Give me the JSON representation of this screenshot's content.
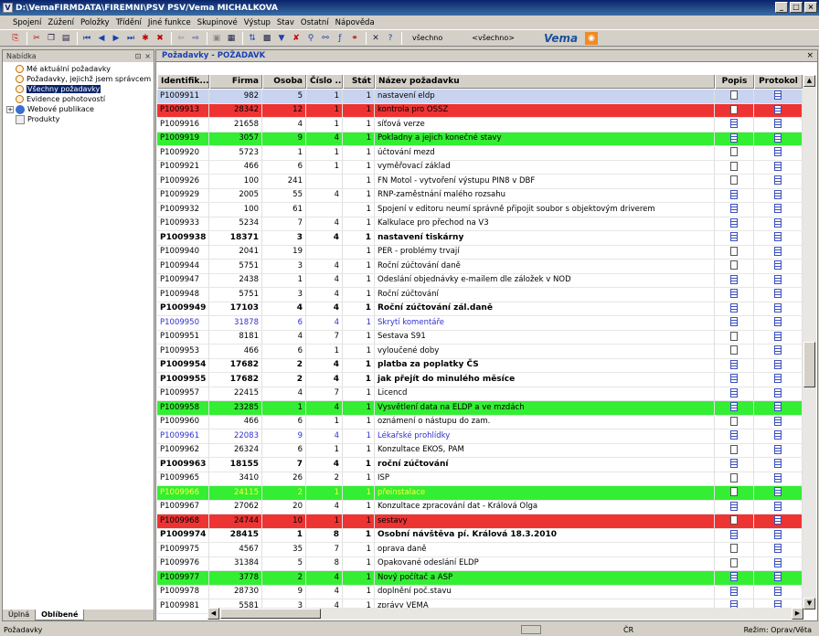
{
  "window": {
    "title": "D:\\VemaFIRMDATA\\FIREMNI\\PSV PSV/Vema MICHALKOVA"
  },
  "menu": [
    "Spojení",
    "Zúžení",
    "Položky",
    "Třídění",
    "Jiné funkce",
    "Skupinové",
    "Výstup",
    "Stav",
    "Ostatní",
    "Nápověda"
  ],
  "toolbar": {
    "filter1": "všechno",
    "filter2": "<všechno>",
    "brand": "Vema"
  },
  "left_panel": {
    "title": "Nabídka",
    "items": [
      "Mé aktuální požadavky",
      "Požadavky, jejichž jsem správcem",
      "Všechny požadavky",
      "Evidence pohotovostí",
      "Webové publikace",
      "Produkty"
    ],
    "tabs": [
      "Úplná",
      "Oblíbené"
    ]
  },
  "main": {
    "title": "Požadavky - POŽADAVK"
  },
  "columns": [
    "Identifik...",
    "Firma",
    "Osoba",
    "Číslo ...",
    "Stát",
    "Název požadavku",
    "Popis",
    "Protokol"
  ],
  "rows": [
    [
      "P1009911",
      "982",
      "5",
      "1",
      "1",
      "nastavení eldp",
      "sel",
      "page",
      "lines"
    ],
    [
      "P1009913",
      "28342",
      "12",
      "1",
      "1",
      "kontrola pro OSSZ",
      "red",
      "page",
      "lines"
    ],
    [
      "P1009916",
      "21658",
      "4",
      "1",
      "1",
      "síťová verze",
      "",
      "lines",
      "lines"
    ],
    [
      "P1009919",
      "3057",
      "9",
      "4",
      "1",
      "Pokladny a jejich konečné stavy",
      "green",
      "lines",
      "lines"
    ],
    [
      "P1009920",
      "5723",
      "1",
      "1",
      "1",
      "účtování mezd",
      "",
      "page",
      "lines"
    ],
    [
      "P1009921",
      "466",
      "6",
      "1",
      "1",
      "vyměřovací základ",
      "",
      "page",
      "lines"
    ],
    [
      "P1009926",
      "100",
      "241",
      "",
      "1",
      "FN Motol - vytvoření výstupu PIN8 v DBF",
      "",
      "page",
      "lines"
    ],
    [
      "P1009929",
      "2005",
      "55",
      "4",
      "1",
      "RNP-zaměstnání malého rozsahu",
      "",
      "lines",
      "lines"
    ],
    [
      "P1009932",
      "100",
      "61",
      "",
      "1",
      "Spojení v editoru neumí správně připojit soubor s objektovým driverem",
      "",
      "lines",
      "lines"
    ],
    [
      "P1009933",
      "5234",
      "7",
      "4",
      "1",
      "Kalkulace pro přechod na V3",
      "",
      "lines",
      "lines"
    ],
    [
      "P1009938",
      "18371",
      "3",
      "4",
      "1",
      "nastavení tiskárny",
      "bold",
      "lines",
      "lines"
    ],
    [
      "P1009940",
      "2041",
      "19",
      "",
      "1",
      "PER - problémy trvají",
      "",
      "page",
      "lines"
    ],
    [
      "P1009944",
      "5751",
      "3",
      "4",
      "1",
      "Roční zúčtování daně",
      "",
      "page",
      "lines"
    ],
    [
      "P1009947",
      "2438",
      "1",
      "4",
      "1",
      "Odeslání objednávky e-mailem dle záložek v NOD",
      "",
      "lines",
      "lines"
    ],
    [
      "P1009948",
      "5751",
      "3",
      "4",
      "1",
      "Roční zúčtování",
      "",
      "lines",
      "lines"
    ],
    [
      "P1009949",
      "17103",
      "4",
      "4",
      "1",
      "Roční zúčtování zál.daně",
      "bold",
      "lines",
      "lines"
    ],
    [
      "P1009950",
      "31878",
      "6",
      "4",
      "1",
      "Skrytí komentáře",
      "blue",
      "lines",
      "lines"
    ],
    [
      "P1009951",
      "8181",
      "4",
      "7",
      "1",
      "Sestava S91",
      "",
      "page",
      "lines"
    ],
    [
      "P1009953",
      "466",
      "6",
      "1",
      "1",
      "vyloučené doby",
      "",
      "page",
      "lines"
    ],
    [
      "P1009954",
      "17682",
      "2",
      "4",
      "1",
      "platba za poplatky ČS",
      "bold",
      "lines",
      "lines"
    ],
    [
      "P1009955",
      "17682",
      "2",
      "4",
      "1",
      "jak přejít do minulého měsíce",
      "bold",
      "lines",
      "lines"
    ],
    [
      "P1009957",
      "22415",
      "4",
      "7",
      "1",
      "Licencd",
      "",
      "lines",
      "lines"
    ],
    [
      "P1009958",
      "23285",
      "1",
      "4",
      "1",
      "Vysvětlení data na ELDP a ve mzdách",
      "green",
      "lines",
      "lines"
    ],
    [
      "P1009960",
      "466",
      "6",
      "1",
      "1",
      "oznámení o nástupu do zam.",
      "",
      "page",
      "lines"
    ],
    [
      "P1009961",
      "22083",
      "9",
      "4",
      "1",
      "Lékařské prohlídky",
      "blue",
      "lines",
      "lines"
    ],
    [
      "P1009962",
      "26324",
      "6",
      "1",
      "1",
      "Konzultace EKOS, PAM",
      "",
      "page",
      "lines"
    ],
    [
      "P1009963",
      "18155",
      "7",
      "4",
      "1",
      "roční zúčtování",
      "bold",
      "lines",
      "lines"
    ],
    [
      "P1009965",
      "3410",
      "26",
      "2",
      "1",
      "ISP",
      "",
      "page",
      "lines"
    ],
    [
      "P1009966",
      "24115",
      "2",
      "1",
      "1",
      "přeinstalace",
      "green yellow",
      "page",
      "lines"
    ],
    [
      "P1009967",
      "27062",
      "20",
      "4",
      "1",
      "Konzultace zpracování dat - Králová Olga",
      "",
      "lines",
      "lines"
    ],
    [
      "P1009968",
      "24744",
      "10",
      "1",
      "1",
      "sestavy",
      "red",
      "page",
      "lines"
    ],
    [
      "P1009974",
      "28415",
      "1",
      "8",
      "1",
      "Osobní návštěva pí. Králová 18.3.2010",
      "bold",
      "lines",
      "lines"
    ],
    [
      "P1009975",
      "4567",
      "35",
      "7",
      "1",
      "oprava daně",
      "",
      "page",
      "lines"
    ],
    [
      "P1009976",
      "31384",
      "5",
      "8",
      "1",
      "Opakované odeslání ELDP",
      "",
      "page",
      "lines"
    ],
    [
      "P1009977",
      "3778",
      "2",
      "4",
      "1",
      "Nový počítač a ASP",
      "green",
      "lines",
      "lines"
    ],
    [
      "P1009978",
      "28730",
      "9",
      "4",
      "1",
      "doplnění poč.stavu",
      "",
      "lines",
      "lines"
    ],
    [
      "P1009981",
      "5581",
      "3",
      "4",
      "1",
      "zprávy VEMA",
      "",
      "lines",
      "lines"
    ]
  ],
  "status": {
    "left": "Požadavky",
    "mid": "ČR",
    "right": "Režim: Oprav/Věta"
  }
}
